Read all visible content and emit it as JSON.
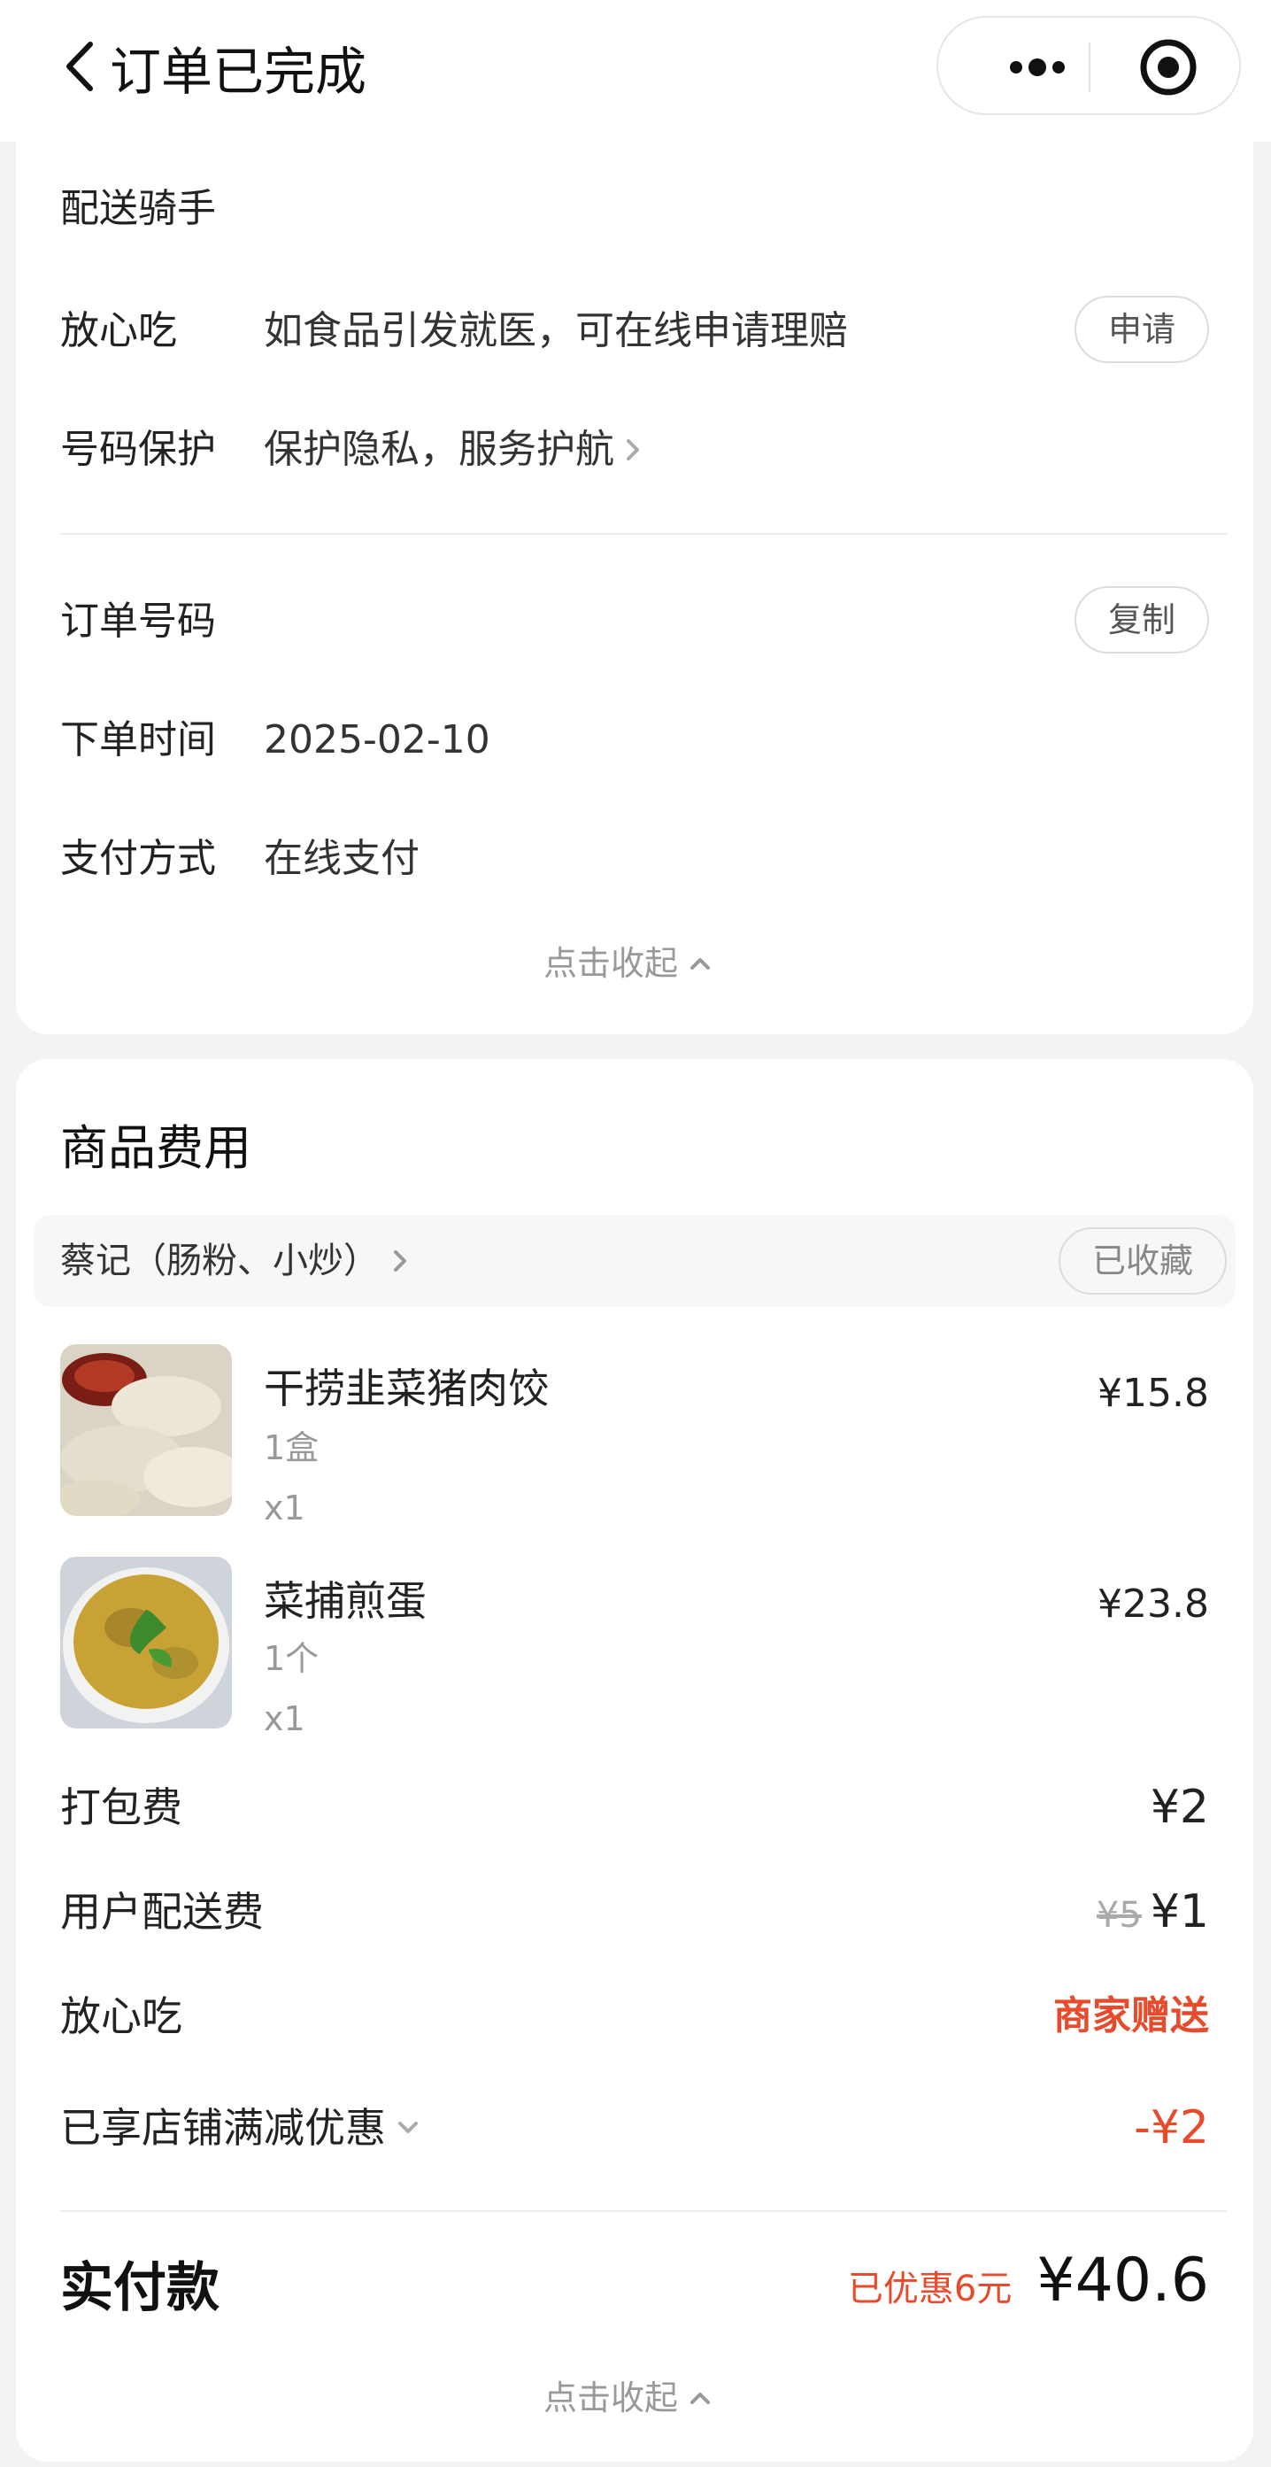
{
  "header": {
    "title": "订单已完成"
  },
  "delivery": {
    "rider_label": "配送骑手",
    "safe_eat_label": "放心吃",
    "safe_eat_value": "如食品引发就医，可在线申请理赔",
    "apply_button": "申请",
    "number_protect_label": "号码保护",
    "number_protect_value": "保护隐私，服务护航"
  },
  "order_info": {
    "order_no_label": "订单号码",
    "copy_button": "复制",
    "order_time_label": "下单时间",
    "order_time_value": "2025-02-10",
    "pay_method_label": "支付方式",
    "pay_method_value": "在线支付",
    "collapse_label": "点击收起"
  },
  "fees": {
    "section_title": "商品费用",
    "shop_name": "蔡记（肠粉、小炒）",
    "favorite_button": "已收藏",
    "items": [
      {
        "name": "干捞韭菜猪肉饺",
        "spec": "1盒",
        "qty": "x1",
        "price": "¥15.8"
      },
      {
        "name": "菜捕煎蛋",
        "spec": "1个",
        "qty": "x1",
        "price": "¥23.8"
      }
    ],
    "packing_label": "打包费",
    "packing_value": "¥2",
    "delivery_fee_label": "用户配送费",
    "delivery_fee_original": "¥5",
    "delivery_fee_value": "¥1",
    "safe_eat_label": "放心吃",
    "safe_eat_value": "商家赠送",
    "discount_label": "已享店铺满减优惠",
    "discount_value": "-¥2",
    "total_label": "实付款",
    "total_discount_note": "已优惠6元",
    "total_value": "¥40.6",
    "collapse_label": "点击收起"
  },
  "colors": {
    "accent_red": "#e84a2c",
    "card_bg": "#ffffff",
    "page_bg": "#f3f3f3"
  }
}
